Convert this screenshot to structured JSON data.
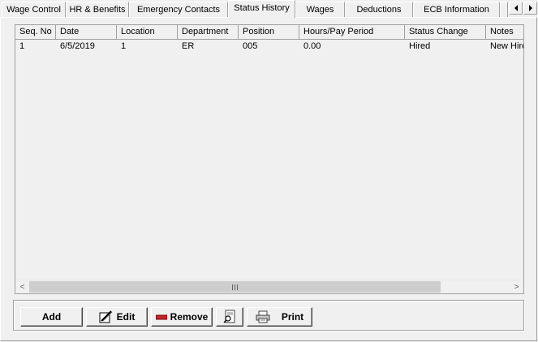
{
  "tabs": [
    {
      "label": "Wage Control"
    },
    {
      "label": "HR & Benefits"
    },
    {
      "label": "Emergency Contacts"
    },
    {
      "label": "Status History",
      "active": true
    },
    {
      "label": "Wages"
    },
    {
      "label": "Deductions"
    },
    {
      "label": "ECB Information"
    }
  ],
  "tab_scroll": {
    "left_icon": "arrow-left-icon",
    "right_icon": "arrow-right-icon"
  },
  "grid": {
    "columns": [
      "Seq. No",
      "Date",
      "Location",
      "Department",
      "Position",
      "Hours/Pay Period",
      "Status Change",
      "Notes"
    ],
    "rows": [
      [
        "1",
        "6/5/2019",
        "1",
        "ER",
        "005",
        "0.00",
        "Hired",
        "New Hire"
      ]
    ],
    "hscroll_left": "<",
    "hscroll_right": ">"
  },
  "buttons": {
    "add": "Add",
    "edit": "Edit",
    "remove": "Remove",
    "print": "Print"
  },
  "icons": {
    "edit": "edit-pencil-icon",
    "remove": "remove-bar-icon",
    "preview": "print-preview-icon",
    "print": "printer-icon"
  },
  "colors": {
    "background": "#f0f0f0",
    "remove_icon": "#c0262c",
    "border_dark": "#a0a0a0"
  }
}
